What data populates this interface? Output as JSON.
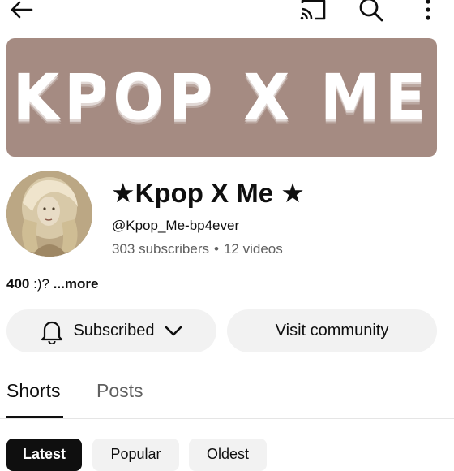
{
  "top_bar": {
    "icons": [
      "back-arrow-icon",
      "cast-icon",
      "search-icon",
      "more-vertical-icon"
    ]
  },
  "banner": {
    "text": "KPOP X ME",
    "background_color": "#a58b82"
  },
  "channel": {
    "name": "★Kpop X Me ★",
    "handle": "@Kpop_Me-bp4ever",
    "subscribers": "303 subscribers",
    "separator": "•",
    "videos": "12 videos"
  },
  "description": {
    "number": "400",
    "text": " :)? ",
    "more": "...more"
  },
  "actions": {
    "subscribed_label": "Subscribed",
    "visit_community_label": "Visit community"
  },
  "tabs": [
    {
      "label": "Shorts",
      "selected": true
    },
    {
      "label": "Posts",
      "selected": false
    }
  ],
  "chips": [
    {
      "label": "Latest",
      "selected": true
    },
    {
      "label": "Popular",
      "selected": false
    },
    {
      "label": "Oldest",
      "selected": false
    }
  ],
  "colors": {
    "text_primary": "#0f0f0f",
    "text_secondary": "#606060",
    "pill_background": "#f2f2f2"
  }
}
